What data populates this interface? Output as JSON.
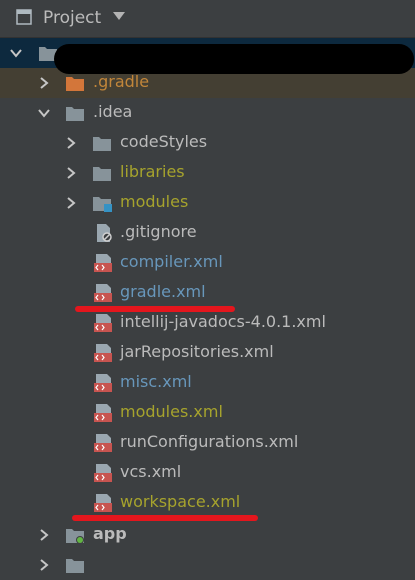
{
  "header": {
    "title": "Project",
    "icon": "project-window-icon"
  },
  "tree": {
    "root": {
      "label": "",
      "redacted": true
    },
    "items": [
      {
        "label": ".gradle",
        "color": "orange"
      },
      {
        "label": ".idea",
        "color": "default"
      },
      {
        "label": "codeStyles",
        "color": "default"
      },
      {
        "label": "libraries",
        "color": "olive"
      },
      {
        "label": "modules",
        "color": "olive"
      },
      {
        "label": ".gitignore",
        "color": "default"
      },
      {
        "label": "compiler.xml",
        "color": "blue"
      },
      {
        "label": "gradle.xml",
        "color": "blue",
        "underlined": true
      },
      {
        "label": "intellij-javadocs-4.0.1.xml",
        "color": "default"
      },
      {
        "label": "jarRepositories.xml",
        "color": "default"
      },
      {
        "label": "misc.xml",
        "color": "blue"
      },
      {
        "label": "modules.xml",
        "color": "olive"
      },
      {
        "label": "runConfigurations.xml",
        "color": "default"
      },
      {
        "label": "vcs.xml",
        "color": "default"
      },
      {
        "label": "workspace.xml",
        "color": "olive",
        "underlined": true
      },
      {
        "label": "app",
        "color": "default"
      }
    ]
  },
  "colors": {
    "background": "#3c3f41",
    "selected_row": "#0d293e",
    "ignored_row": "#443f33",
    "text_default": "#bbbbbb",
    "text_blue": "#6897bb",
    "text_olive": "#a6a32d",
    "text_orange": "#c2863a",
    "underline_red": "#e4161d"
  }
}
